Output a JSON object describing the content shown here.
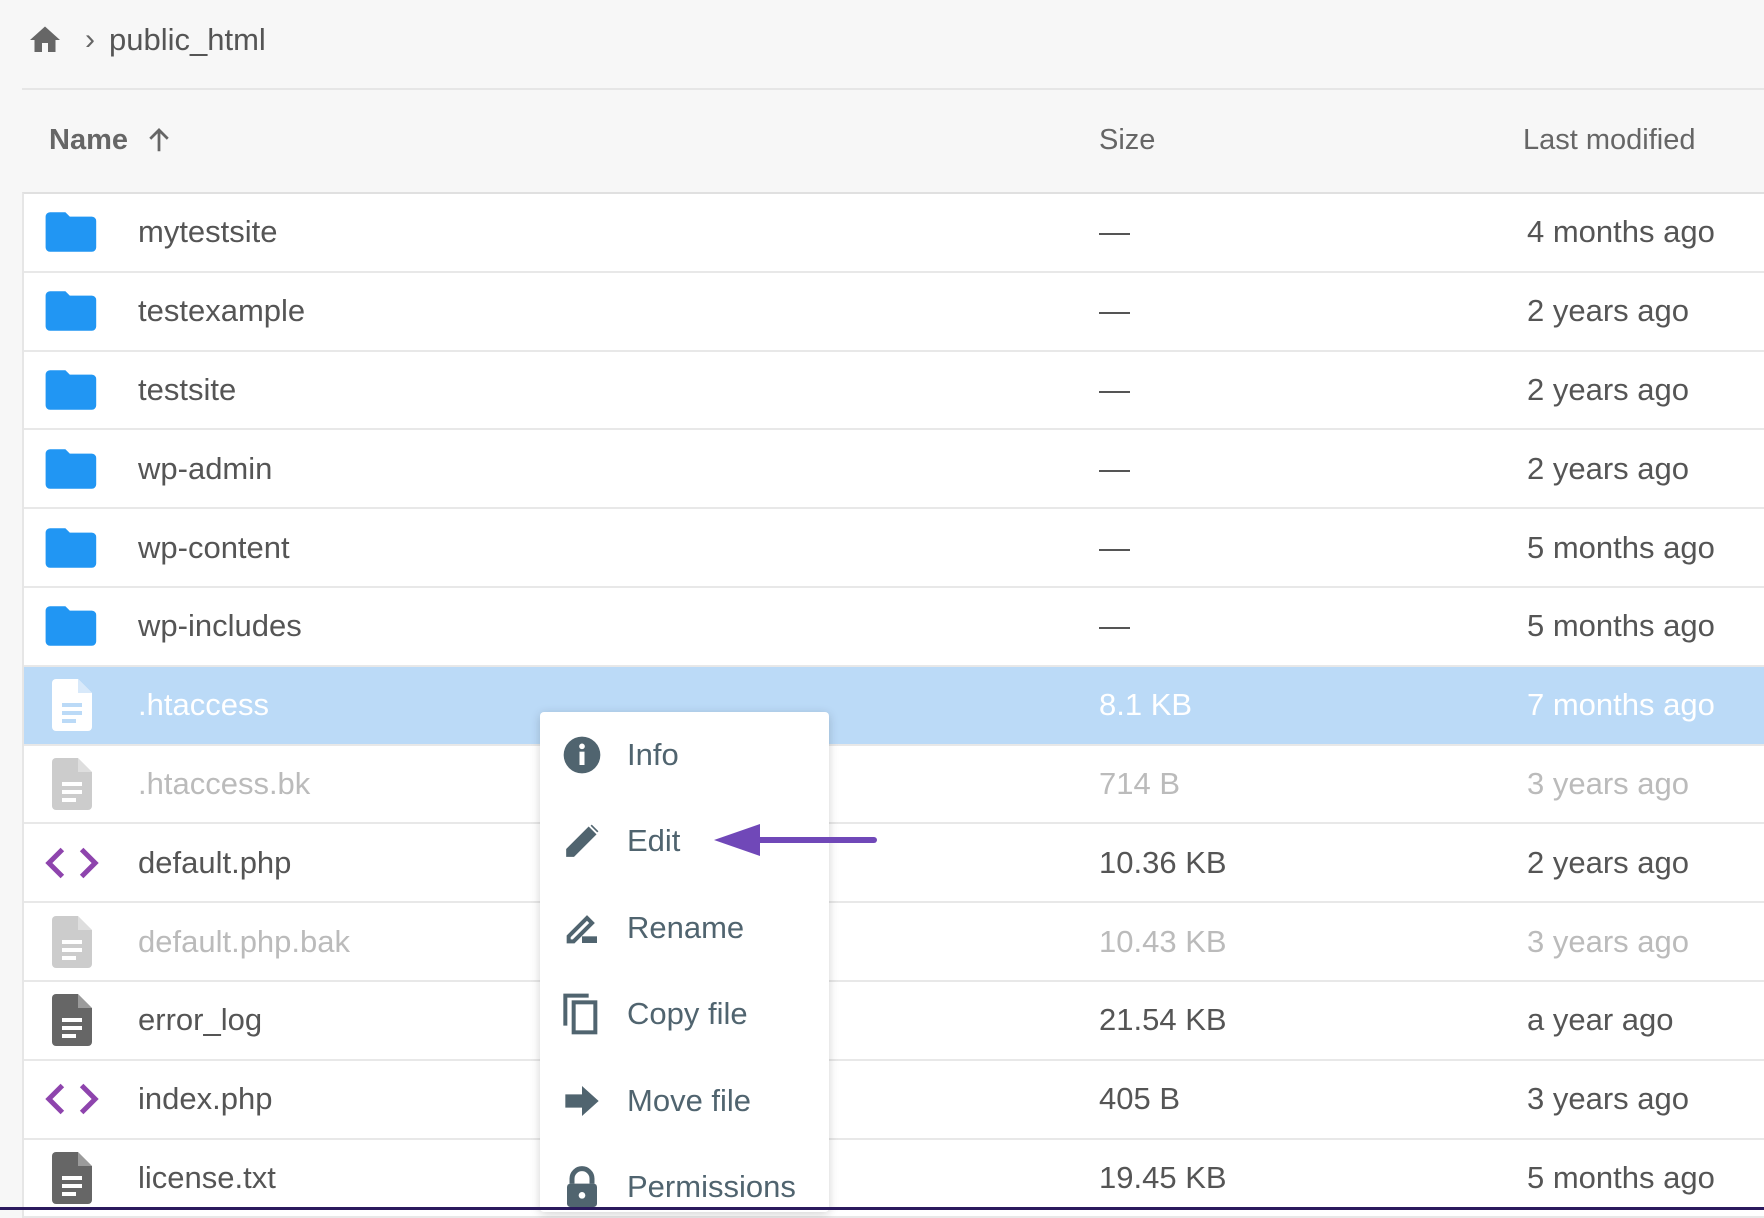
{
  "breadcrumb": {
    "home_icon": "home-icon",
    "separator_icon": "chevron-right-icon",
    "current": "public_html"
  },
  "header": {
    "name": "Name",
    "sort_icon": "arrow-up-icon",
    "size": "Size",
    "last_modified": "Last modified"
  },
  "files": [
    {
      "name": "mytestsite",
      "size": "—",
      "modified": "4 months ago",
      "type": "folder"
    },
    {
      "name": "testexample",
      "size": "—",
      "modified": "2 years ago",
      "type": "folder"
    },
    {
      "name": "testsite",
      "size": "—",
      "modified": "2 years ago",
      "type": "folder"
    },
    {
      "name": "wp-admin",
      "size": "—",
      "modified": "2 years ago",
      "type": "folder"
    },
    {
      "name": "wp-content",
      "size": "—",
      "modified": "5 months ago",
      "type": "folder"
    },
    {
      "name": "wp-includes",
      "size": "—",
      "modified": "5 months ago",
      "type": "folder"
    },
    {
      "name": ".htaccess",
      "size": "8.1 KB",
      "modified": "7 months ago",
      "type": "file",
      "state": "selected"
    },
    {
      "name": ".htaccess.bk",
      "size": "714 B",
      "modified": "3 years ago",
      "type": "file",
      "state": "dimmed"
    },
    {
      "name": "default.php",
      "size": "10.36 KB",
      "modified": "2 years ago",
      "type": "code"
    },
    {
      "name": "default.php.bak",
      "size": "10.43 KB",
      "modified": "3 years ago",
      "type": "file",
      "state": "dimmed"
    },
    {
      "name": "error_log",
      "size": "21.54 KB",
      "modified": "a year ago",
      "type": "file"
    },
    {
      "name": "index.php",
      "size": "405 B",
      "modified": "3 years ago",
      "type": "code"
    },
    {
      "name": "license.txt",
      "size": "19.45 KB",
      "modified": "5 months ago",
      "type": "file"
    }
  ],
  "context_menu": [
    {
      "label": "Info",
      "icon": "info-icon"
    },
    {
      "label": "Edit",
      "icon": "pencil-icon"
    },
    {
      "label": "Rename",
      "icon": "rename-icon"
    },
    {
      "label": "Copy file",
      "icon": "copy-icon"
    },
    {
      "label": "Move file",
      "icon": "arrow-right-icon"
    },
    {
      "label": "Permissions",
      "icon": "lock-icon"
    }
  ],
  "colors": {
    "folder": "#2196f3",
    "selected_row": "#bbdaf7",
    "code_icon": "#8e44ad",
    "annotation_arrow": "#7048b8",
    "menu_text": "#50646f"
  }
}
